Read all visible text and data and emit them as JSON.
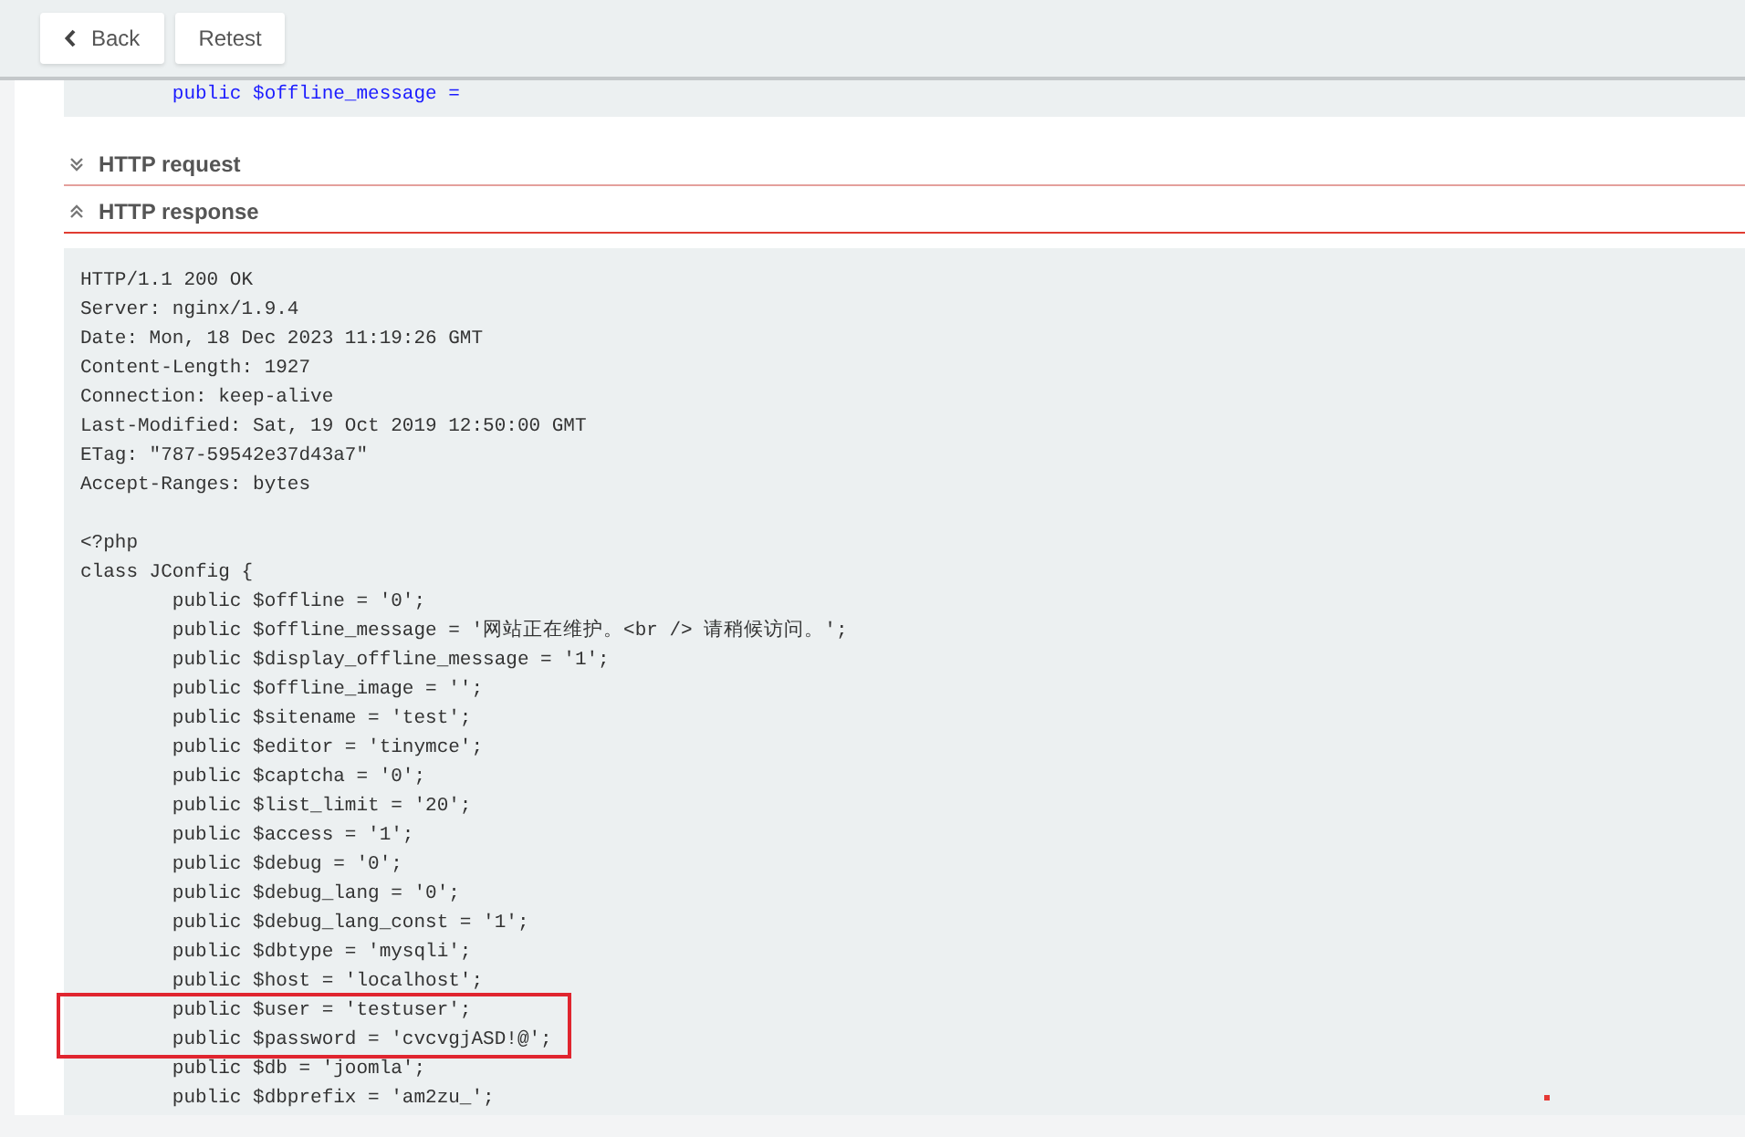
{
  "toolbar": {
    "buttons": [
      {
        "kind": "back",
        "label": "Back"
      },
      {
        "kind": "plain",
        "label": "Retest"
      }
    ]
  },
  "previous_code": {
    "lines": [
      "        public $offline_message ="
    ]
  },
  "sections": [
    {
      "title": "HTTP request",
      "expanded": false
    },
    {
      "title": "HTTP response",
      "expanded": true
    }
  ],
  "response": {
    "blocks": [
      {
        "kind": "headers",
        "boxed": false,
        "lines": [
          "HTTP/1.1 200 OK",
          "Server: nginx/1.9.4",
          "Date: Mon, 18 Dec 2023 11:19:26 GMT",
          "Content-Length: 1927",
          "Connection: keep-alive",
          "Last-Modified: Sat, 19 Oct 2019 12:50:00 GMT",
          "ETag: \"787-59542e37d43a7\"",
          "Accept-Ranges: bytes"
        ]
      },
      {
        "kind": "code",
        "boxed": false,
        "lines": [
          "<?php",
          "class JConfig {",
          "        public $offline = '0';",
          "        public $offline_message = '网站正在维护。<br /> 请稍候访问。';",
          "        public $display_offline_message = '1';",
          "        public $offline_image = '';",
          "        public $sitename = 'test';",
          "        public $editor = 'tinymce';",
          "        public $captcha = '0';",
          "        public $list_limit = '20';",
          "        public $access = '1';",
          "        public $debug = '0';",
          "        public $debug_lang = '0';",
          "        public $debug_lang_const = '1';",
          "        public $dbtype = 'mysqli';",
          "        public $host = 'localhost';"
        ]
      },
      {
        "kind": "code",
        "boxed": true,
        "lines": [
          "        public $user = 'testuser';",
          "        public $password = 'cvcvgjASD!@';"
        ]
      },
      {
        "kind": "code",
        "boxed": false,
        "lines": [
          "        public $db = 'joomla';",
          "        public $dbprefix = 'am2zu_';"
        ]
      }
    ]
  }
}
